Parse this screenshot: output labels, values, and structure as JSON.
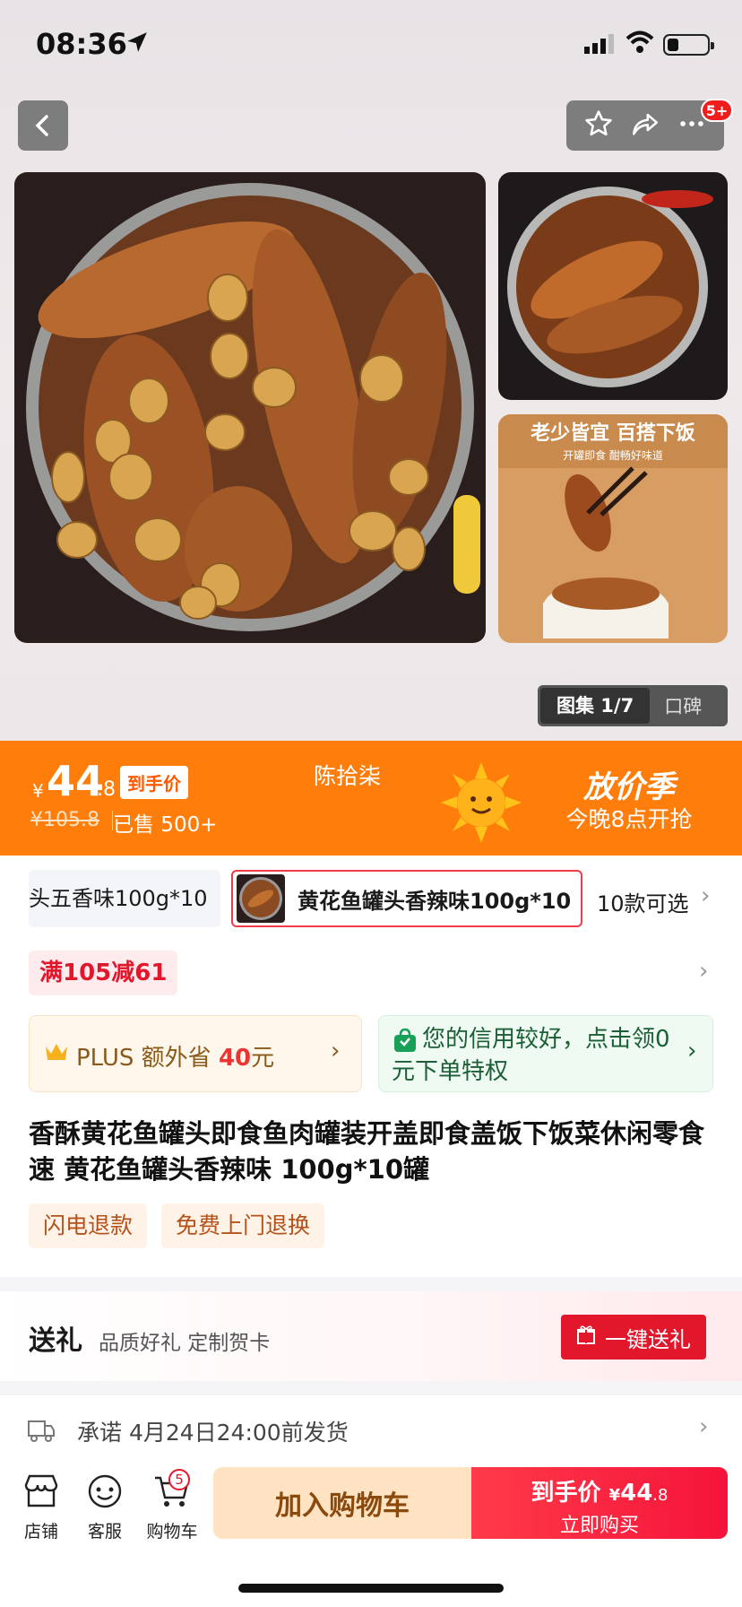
{
  "status_bar": {
    "time": "08:36"
  },
  "header": {
    "notification_badge": "5+"
  },
  "gallery": {
    "tab_gallery": "图集 1/7",
    "tab_reviews": "口碑"
  },
  "price": {
    "currency": "¥",
    "integer": "44",
    "decimal": ".8",
    "final_price_tag": "到手价",
    "original_price": "¥105.8",
    "sold": "已售 500+",
    "shop_name": "陈拾柒",
    "promo_title": "放价季",
    "promo_subtitle": "今晚8点开抢"
  },
  "variants": {
    "items": [
      {
        "label": "头五香味100g*10"
      },
      {
        "label": "黄花鱼罐头香辣味100g*10"
      }
    ],
    "more": "10款可选"
  },
  "coupon": {
    "label": "满105减61"
  },
  "plus": {
    "prefix": "PLUS 额外省 ",
    "amount": "40",
    "suffix": "元"
  },
  "credit": {
    "text": "您的信用较好，点击领0元下单特权"
  },
  "product": {
    "title": "香酥黄花鱼罐头即食鱼肉罐装开盖即食盖饭下饭菜休闲零食速 黄花鱼罐头香辣味 100g*10罐",
    "tags": [
      "闪电退款",
      "免费上门退换"
    ]
  },
  "gift": {
    "title": "送礼",
    "subtitle": "品质好礼 定制贺卡",
    "button": "一键送礼"
  },
  "shipping": {
    "text": "承诺 4月24日24:00前发货"
  },
  "bottom_bar": {
    "store": "店铺",
    "service": "客服",
    "cart": "购物车",
    "cart_count": "5",
    "add_to_cart": "加入购物车",
    "buy_label": "到手价",
    "buy_currency": "¥",
    "buy_int": "44",
    "buy_dec": ".8",
    "buy_now": "立即购买"
  },
  "colors": {
    "accent_orange": "#ff7d0a",
    "accent_red": "#e3172c",
    "buy_red": "#f5143a"
  }
}
